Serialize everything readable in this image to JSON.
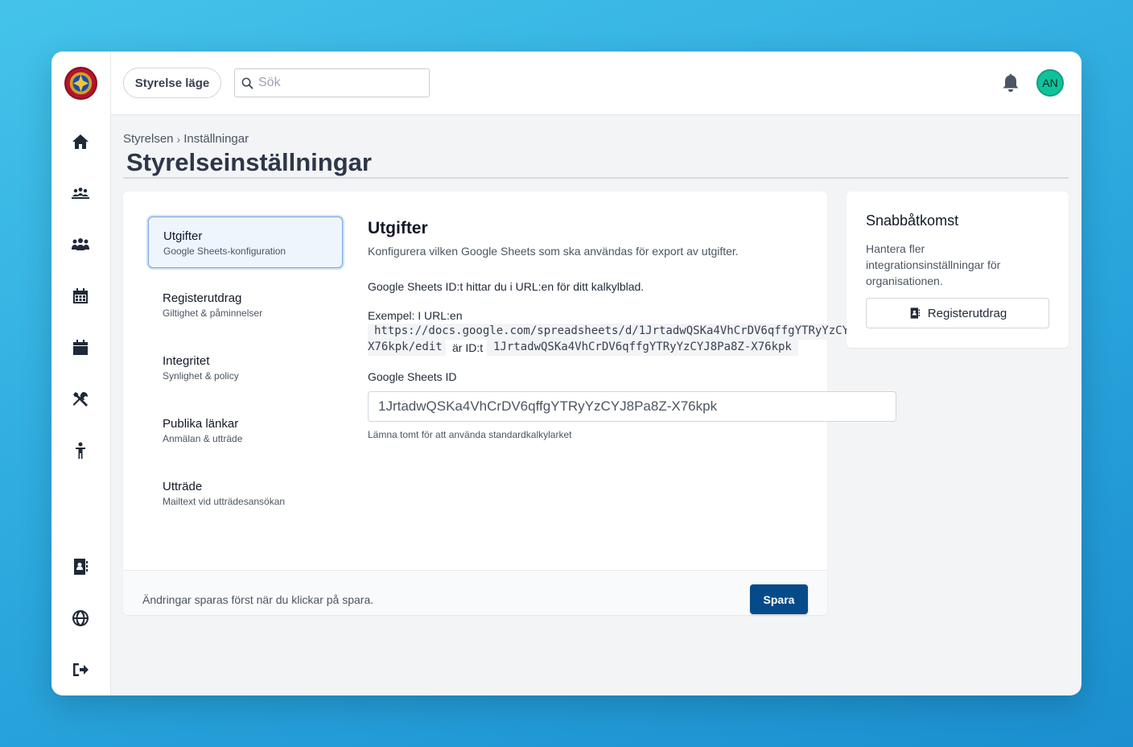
{
  "topbar": {
    "mode_button": "Styrelse läge",
    "search_placeholder": "Sök",
    "avatar_initials": "AN"
  },
  "breadcrumb": [
    "Styrelsen",
    "Inställningar"
  ],
  "page_title": "Styrelseinställningar",
  "subnav": [
    {
      "title": "Utgifter",
      "subtitle": "Google Sheets-konfiguration",
      "active": true
    },
    {
      "title": "Registerutdrag",
      "subtitle": "Giltighet & påminnelser"
    },
    {
      "title": "Integritet",
      "subtitle": "Synlighet & policy"
    },
    {
      "title": "Publika länkar",
      "subtitle": "Anmälan & utträde"
    },
    {
      "title": "Utträde",
      "subtitle": "Mailtext vid utträdesansökan"
    }
  ],
  "section": {
    "title": "Utgifter",
    "description": "Konfigurera vilken Google Sheets som ska användas för export av utgifter.",
    "info": "Google Sheets ID:t hittar du i URL:en för ditt kalkylblad.",
    "example_label": "Exempel: I URL:en",
    "example_url_line1": "https://docs.google.com/spreadsheets/d/1JrtadwQSKa4VhCrDV6qffgYTRyYzCY",
    "example_url_line2": "X76kpk/edit",
    "example_join": "är ID:t",
    "example_id": "1JrtadwQSKa4VhCrDV6qffgYTRyYzCYJ8Pa8Z-X76kpk",
    "field_label": "Google Sheets ID",
    "field_value": "1JrtadwQSKa4VhCrDV6qffgYTRyYzCYJ8Pa8Z-X76kpk",
    "field_hint": "Lämna tomt för att använda standardkalkylarket"
  },
  "footer": {
    "note": "Ändringar sparas först när du klickar på spara.",
    "save_label": "Spara"
  },
  "quick_access": {
    "title": "Snabbåtkomst",
    "description": "Hantera fler integrationsinställningar för organisationen.",
    "button_label": "Registerutdrag"
  },
  "icons": {
    "sidebar": [
      "home-icon",
      "meeting-icon",
      "members-icon",
      "calendar-grid-icon",
      "calendar-icon",
      "tools-icon",
      "child-icon",
      "contact-card-icon",
      "globe-icon",
      "logout-icon"
    ],
    "topbar": [
      "search-icon",
      "bell-icon"
    ]
  },
  "colors": {
    "accent": "#054b8a",
    "avatar": "#10c29b",
    "active_item_bg": "#eef5fd"
  }
}
